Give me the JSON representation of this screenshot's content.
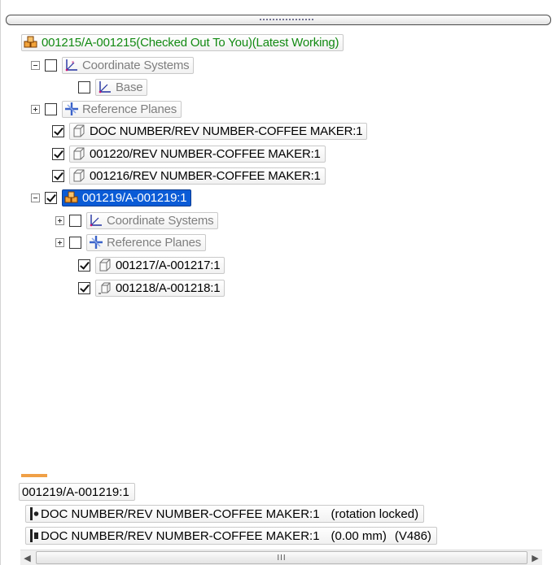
{
  "tree": {
    "root": {
      "label": "001215/A-001215(Checked Out To You)(Latest Working)"
    },
    "coord_systems": {
      "label": "Coordinate Systems",
      "checked": false,
      "expanded": true
    },
    "base": {
      "label": "Base",
      "checked": false
    },
    "ref_planes": {
      "label": "Reference Planes",
      "checked": false,
      "expanded": false
    },
    "part_doc": {
      "label": "DOC NUMBER/REV NUMBER-COFFEE MAKER:1",
      "checked": true
    },
    "part_1220": {
      "label": "001220/REV NUMBER-COFFEE MAKER:1",
      "checked": true
    },
    "part_1216": {
      "label": "001216/REV NUMBER-COFFEE MAKER:1",
      "checked": true
    },
    "sub_asm": {
      "label": "001219/A-001219:1",
      "checked": true,
      "selected": true,
      "expanded": true
    },
    "sub_coord": {
      "label": "Coordinate Systems",
      "checked": false,
      "expanded": false
    },
    "sub_ref": {
      "label": "Reference Planes",
      "checked": false,
      "expanded": false
    },
    "part_1217": {
      "label": "001217/A-001217:1",
      "checked": true
    },
    "part_1218": {
      "label": "001218/A-001218:1",
      "checked": true
    }
  },
  "status": {
    "selected_item": "001219/A-001219:1",
    "rel1": {
      "part": "DOC NUMBER/REV NUMBER-COFFEE MAKER:1",
      "detail": "(rotation locked)"
    },
    "rel2": {
      "part": "DOC NUMBER/REV NUMBER-COFFEE MAKER:1",
      "offset": "(0.00 mm)",
      "code": "(V486)"
    }
  },
  "scrollbar": {
    "left_arrow": "◀",
    "right_arrow": "▶",
    "grip": "III"
  },
  "colors": {
    "selection": "#0a5bd6",
    "root_text": "#138a13",
    "disabled_text": "#7f7f7f",
    "accent_bar": "#f0a046"
  }
}
